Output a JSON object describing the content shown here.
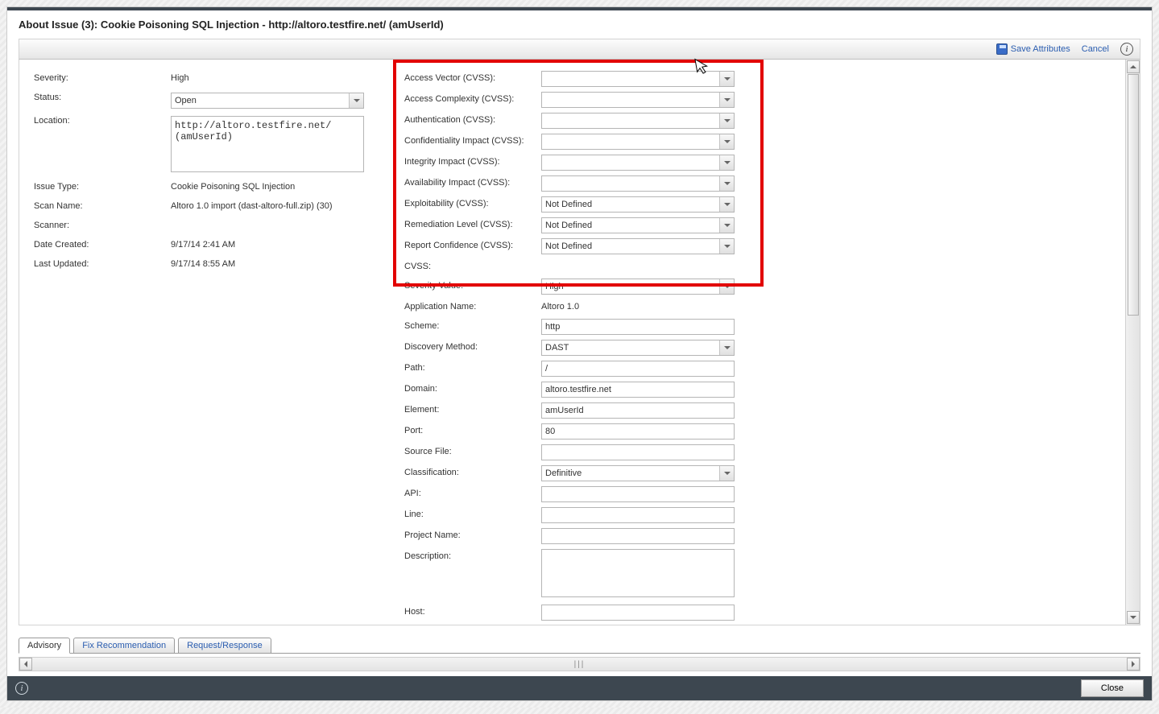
{
  "title": "About Issue (3): Cookie Poisoning SQL Injection - http://altoro.testfire.net/ (amUserId)",
  "toolbar": {
    "save": "Save Attributes",
    "cancel": "Cancel"
  },
  "left": {
    "severity_label": "Severity:",
    "severity_value": "High",
    "status_label": "Status:",
    "status_value": "Open",
    "location_label": "Location:",
    "location_value": "http://altoro.testfire.net/ (amUserId)",
    "issuetype_label": "Issue Type:",
    "issuetype_value": "Cookie Poisoning SQL Injection",
    "scanname_label": "Scan Name:",
    "scanname_value": "Altoro 1.0 import (dast-altoro-full.zip) (30)",
    "scanner_label": "Scanner:",
    "scanner_value": "",
    "datecreated_label": "Date Created:",
    "datecreated_value": "9/17/14 2:41 AM",
    "lastupdated_label": "Last Updated:",
    "lastupdated_value": "9/17/14 8:55 AM"
  },
  "right": {
    "access_vector_label": "Access Vector (CVSS):",
    "access_vector_value": "",
    "access_complexity_label": "Access Complexity (CVSS):",
    "access_complexity_value": "",
    "authentication_label": "Authentication (CVSS):",
    "authentication_value": "",
    "confidentiality_label": "Confidentiality Impact (CVSS):",
    "confidentiality_value": "",
    "integrity_label": "Integrity Impact (CVSS):",
    "integrity_value": "",
    "availability_label": "Availability Impact (CVSS):",
    "availability_value": "",
    "exploitability_label": "Exploitability (CVSS):",
    "exploitability_value": "Not Defined",
    "remediation_label": "Remediation Level (CVSS):",
    "remediation_value": "Not Defined",
    "reportconf_label": "Report Confidence (CVSS):",
    "reportconf_value": "Not Defined",
    "cvss_label": "CVSS:",
    "cvss_value": "",
    "sevvalue_label": "Severity Value:",
    "sevvalue_value": "High",
    "appname_label": "Application Name:",
    "appname_value": "Altoro 1.0",
    "scheme_label": "Scheme:",
    "scheme_value": "http",
    "discovery_label": "Discovery Method:",
    "discovery_value": "DAST",
    "path_label": "Path:",
    "path_value": "/",
    "domain_label": "Domain:",
    "domain_value": "altoro.testfire.net",
    "element_label": "Element:",
    "element_value": "amUserId",
    "port_label": "Port:",
    "port_value": "80",
    "sourcefile_label": "Source File:",
    "sourcefile_value": "",
    "classification_label": "Classification:",
    "classification_value": "Definitive",
    "api_label": "API:",
    "api_value": "",
    "line_label": "Line:",
    "line_value": "",
    "projectname_label": "Project Name:",
    "projectname_value": "",
    "description_label": "Description:",
    "description_value": "",
    "host_label": "Host:",
    "host_value": ""
  },
  "tabs": {
    "advisory": "Advisory",
    "fix": "Fix Recommendation",
    "reqres": "Request/Response"
  },
  "footer": {
    "close": "Close"
  }
}
